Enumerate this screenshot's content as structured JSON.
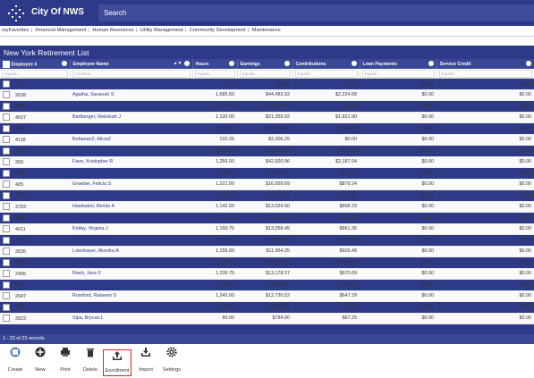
{
  "app": {
    "title": "City Of NWS",
    "search_placeholder": "Search"
  },
  "nav": {
    "items": [
      "myFavorites",
      "Financial Management",
      "Human Resources",
      "Utility Management",
      "Community Development",
      "Maintenance"
    ]
  },
  "panel": {
    "title": "New York Retirement List"
  },
  "table": {
    "columns": [
      "Employee #",
      "Employee Name",
      "Hours",
      "Earnings",
      "Contributions",
      "Loan Payments",
      "Service Credit"
    ],
    "filters": [
      "Equals...",
      "Contains",
      "Equals...",
      "Equals...",
      "Equals...",
      "Equals...",
      "Equals..."
    ],
    "rows": [
      [
        "374",
        "Abigan-tus, Darian V",
        "0.00",
        "$0.00",
        "$0.00",
        "$0.00",
        "$0.00"
      ],
      [
        "2638",
        "Agatha, Savanah S",
        "1,685.50",
        "$44,483.52",
        "$2,224.68",
        "$0.00",
        "$0.00"
      ],
      [
        "2987",
        "Allbritton, Eden N",
        "1,120.00",
        "$12,107.20",
        "$0.00",
        "$0.00",
        "$0.00"
      ],
      [
        "4027",
        "Bartberger, Rebekah J",
        "1,120.00",
        "$21,255.92",
        "$1,821.90",
        "$0.00",
        "$0.00"
      ],
      [
        "4030",
        "Billa, Kaelyn K",
        "1,120.00",
        "$10,976.00",
        "$548.80",
        "$0.00",
        "$0.00"
      ],
      [
        "4118",
        "Bohanan2, Alicia2",
        "132.25",
        "$3,306.25",
        "$0.00",
        "$0.00",
        "$0.00"
      ],
      [
        "4032",
        "Bynoe, Shakira L",
        "1,130.75",
        "$11,081.35",
        "$556.52",
        "$0.00",
        "$0.00"
      ],
      [
        "309",
        "Fann, Kristopher R",
        "1,256.00",
        "$42,920.96",
        "$2,187.04",
        "$0.00",
        "$0.00"
      ],
      [
        "3641",
        "Forest, Wesley A",
        "1,159.50",
        "$13,334.26",
        "$675.34",
        "$0.00",
        "$0.00"
      ],
      [
        "405",
        "Graeber, Felicia S",
        "1,221.00",
        "$16,959.69",
        "$879.24",
        "$0.00",
        "$0.00"
      ],
      [
        "2633",
        "Hazberry, Hector J",
        "1,272.25",
        "$26,761.75",
        "$1,345.96",
        "$0.00",
        "$0.00"
      ],
      [
        "3783",
        "Hawbaker, Benito A",
        "1,142.50",
        "$13,024.50",
        "$668.33",
        "$0.00",
        "$0.00"
      ],
      [
        "3968",
        "Jepko, Rashawn T",
        "1,172.00",
        "$13,185.01",
        "$667.69",
        "$0.00",
        "$0.00"
      ],
      [
        "4011",
        "Kirkby, Virginia J",
        "1,160.75",
        "$13,058.45",
        "$661.36",
        "$0.00",
        "$0.00"
      ],
      [
        "3700",
        "Kumar, Jackson J",
        "1,156.00",
        "$13,005.00",
        "$658.69",
        "$0.00",
        "$0.00"
      ],
      [
        "3635",
        "Loterbauer, Alondra A",
        "1,155.00",
        "$11,954.25",
        "$605.48",
        "$0.00",
        "$0.00"
      ],
      [
        "2585",
        "Olivid, Paris P",
        "1,231.25",
        "$51,791.33",
        "$2,854.33",
        "$0.00",
        "$0.00"
      ],
      [
        "2495",
        "Reeh, Jace F",
        "1,239.75",
        "$13,178.57",
        "$670.09",
        "$0.00",
        "$0.00"
      ],
      [
        "3970",
        "Riha, Maura C",
        "1,216.00",
        "$13,680.00",
        "$703.69",
        "$0.00",
        "$0.00"
      ],
      [
        "2947",
        "Rumford, Raheem S",
        "1,242.00",
        "$12,730.52",
        "$647.29",
        "$0.00",
        "$0.00"
      ],
      [
        "4081",
        "Schulte, James II",
        "259.00",
        "$12,950.00",
        "$0.00",
        "$0.00",
        "$0.00"
      ],
      [
        "3923",
        "Sipa, Brycan L",
        "80.00",
        "$784.00",
        "$67.25",
        "$0.00",
        "$0.00"
      ]
    ]
  },
  "status": {
    "records": "1 - 23 of 23 records"
  },
  "toolbar": {
    "items": [
      "Create",
      "New",
      "Print",
      "Delete",
      "Enrollment",
      "Import",
      "Settings"
    ],
    "selected": "Enrollment"
  },
  "colors": {
    "header": "#2e3a87",
    "accent_highlight": "#d9211f"
  }
}
